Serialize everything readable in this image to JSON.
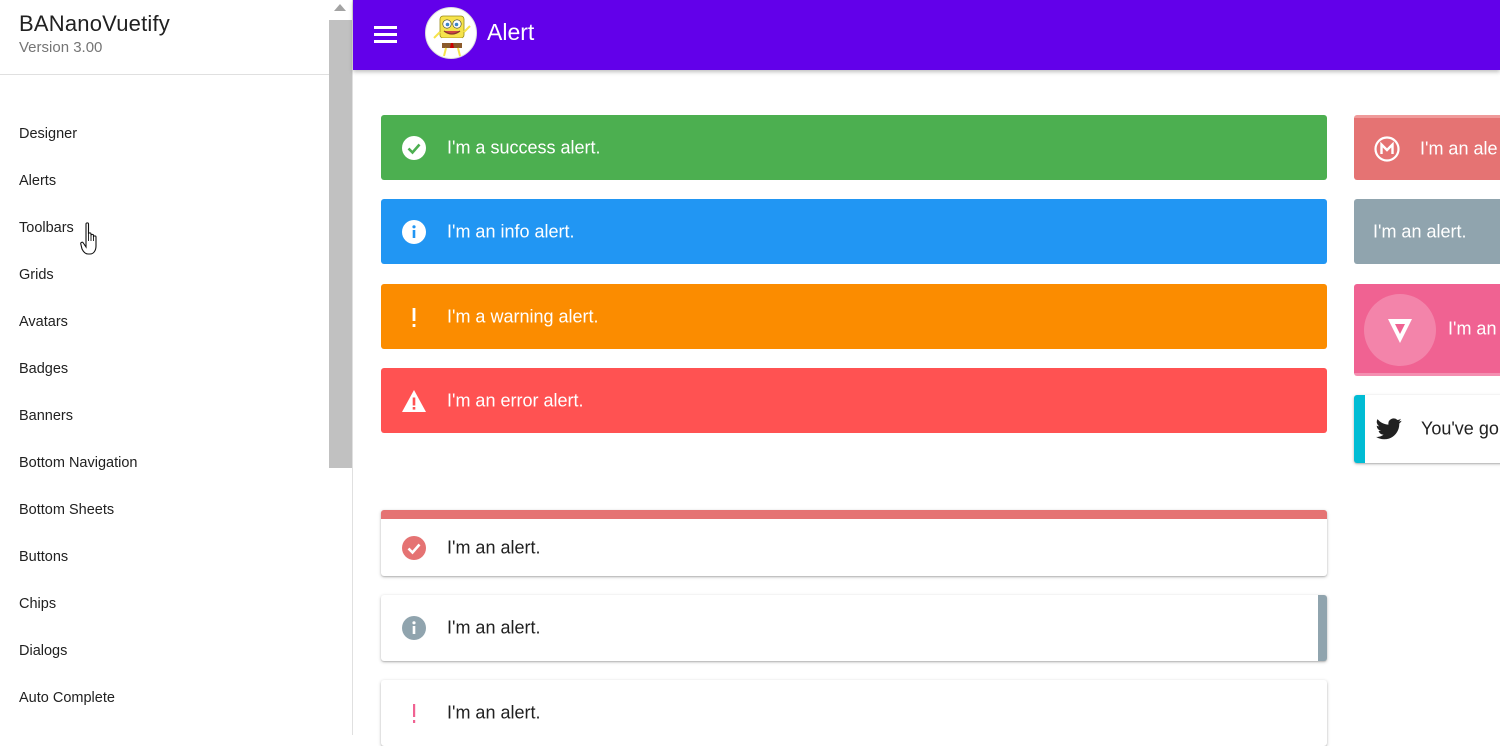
{
  "sidebar": {
    "title": "BANanoVuetify",
    "version": "Version 3.00",
    "items": [
      {
        "label": "Designer"
      },
      {
        "label": "Alerts"
      },
      {
        "label": "Toolbars"
      },
      {
        "label": "Grids"
      },
      {
        "label": "Avatars"
      },
      {
        "label": "Badges"
      },
      {
        "label": "Banners"
      },
      {
        "label": "Bottom Navigation"
      },
      {
        "label": "Bottom Sheets"
      },
      {
        "label": "Buttons"
      },
      {
        "label": "Chips"
      },
      {
        "label": "Dialogs"
      },
      {
        "label": "Auto Complete"
      }
    ]
  },
  "header": {
    "title": "Alert",
    "menu_icon": "menu-icon",
    "avatar": "spongebob-avatar"
  },
  "colors": {
    "primary": "#6200ea",
    "success": "#4caf50",
    "info": "#2196f3",
    "warning": "#fb8c00",
    "error": "#ff5252",
    "red_lighten": "#e57373",
    "blue_grey": "#90a4ae",
    "pink": "#f06292",
    "cyan": "#00bcd4"
  },
  "alerts": {
    "success": "I'm a success alert.",
    "info": "I'm an info alert.",
    "warning": "I'm a warning alert.",
    "error": "I'm an error alert.",
    "border_top": "I'm an alert.",
    "border_right": "I'm an alert.",
    "border_left": "I'm an alert.",
    "right_col_1": "I'm an ale",
    "right_col_2": "I'm an alert.",
    "right_col_3": "I'm an",
    "right_col_4": "You've go"
  }
}
